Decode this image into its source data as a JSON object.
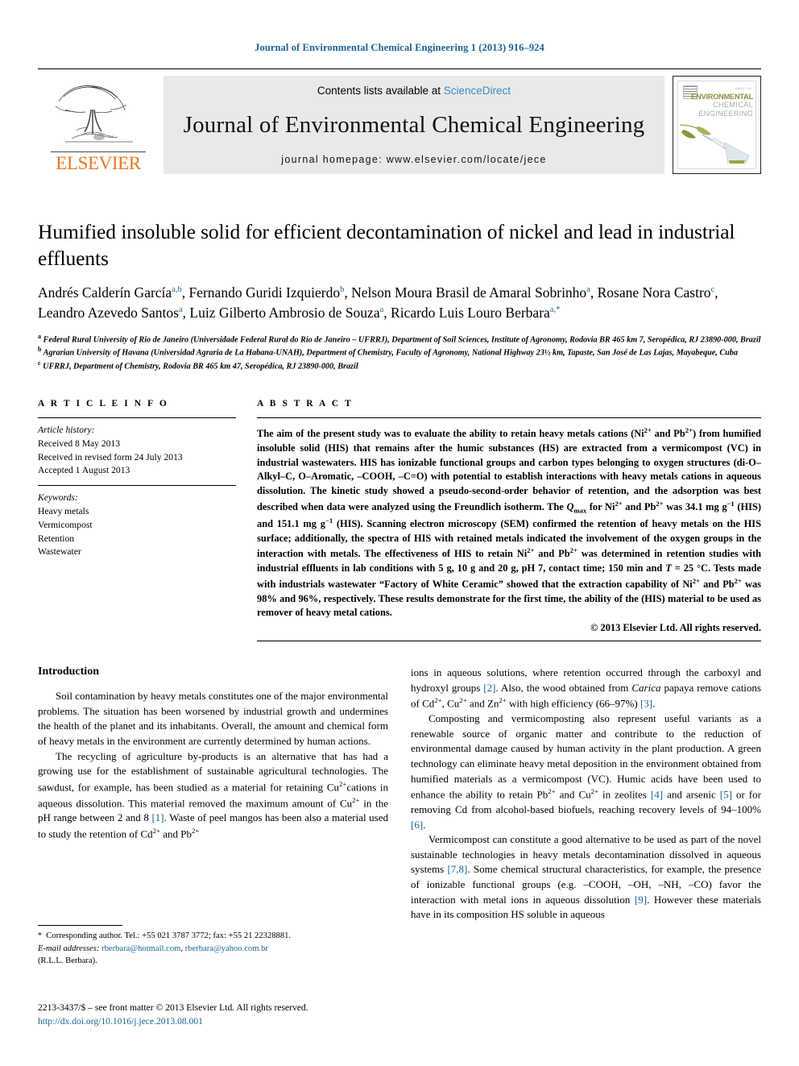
{
  "running_head": "Journal of Environmental Chemical Engineering 1 (2013) 916–924",
  "masthead": {
    "contents_prefix": "Contents lists available at",
    "sciencedirect": "ScienceDirect",
    "journal_title": "Journal of Environmental Chemical Engineering",
    "homepage": "journal homepage: www.elsevier.com/locate/jece",
    "publisher_wordmark": "ELSEVIER",
    "cover": {
      "kicker": "DALL 24",
      "line1": "ENVIRONMENTAL",
      "line2": "CHEMICAL",
      "line3": "ENGINEERING"
    }
  },
  "article": {
    "title": "Humified insoluble solid for efficient decontamination of nickel and lead in industrial effluents",
    "authors": [
      {
        "name": "Andrés Calderín García",
        "sup": "a,b"
      },
      {
        "name": "Fernando Guridi Izquierdo",
        "sup": "b"
      },
      {
        "name": "Nelson Moura Brasil de Amaral Sobrinho",
        "sup": "a"
      },
      {
        "name": "Rosane Nora Castro",
        "sup": "c"
      },
      {
        "name": "Leandro Azevedo Santos",
        "sup": "a"
      },
      {
        "name": "Luiz Gilberto Ambrosio de Souza",
        "sup": "a"
      },
      {
        "name": "Ricardo Luis Louro Berbara",
        "sup": "a,*"
      }
    ],
    "affiliations": [
      {
        "mark": "a",
        "text": "Federal Rural University of Rio de Janeiro (Universidade Federal Rural do Rio de Janeiro – UFRRJ), Department of Soil Sciences, Institute of Agronomy, Rodovia BR 465 km 7, Seropédica, RJ 23890-000, Brazil"
      },
      {
        "mark": "b",
        "text": "Agrarian University of Havana (Universidad Agraria de La Habana-UNAH), Department of Chemistry, Faculty of Agronomy, National Highway 23½ km, Tapaste, San José de Las Lajas, Mayabeque, Cuba"
      },
      {
        "mark": "c",
        "text": "UFRRJ, Department of Chemistry, Rodovia BR 465 km 47, Seropédica, RJ 23890-000, Brazil"
      }
    ]
  },
  "article_info": {
    "label": "A R T I C L E   I N F O",
    "history_label": "Article history:",
    "history": [
      "Received 8 May 2013",
      "Received in revised form 24 July 2013",
      "Accepted 1 August 2013"
    ],
    "keywords_label": "Keywords:",
    "keywords": [
      "Heavy metals",
      "Vermicompost",
      "Retention",
      "Wastewater"
    ]
  },
  "abstract": {
    "label": "A B S T R A C T",
    "paragraph_html": "The aim of the present study was to evaluate the ability to retain heavy metals cations (Ni<sup>2+</sup> and Pb<sup>2+</sup>) from humified insoluble solid (HIS) that remains after the humic substances (HS) are extracted from a vermicompost (VC) in industrial wastewaters. HIS has ionizable functional groups and carbon types belonging to oxygen structures (di-O–Alkyl–C, O–Aromatic, –COOH, –C=O) with potential to establish interactions with heavy metals cations in aqueous dissolution. The kinetic study showed a pseudo-second-order behavior of retention, and the adsorption was best described when data were analyzed using the Freundlich isotherm. The <i>Q</i><sub>max</sub> for Ni<sup>2+</sup> and Pb<sup>2+</sup> was 34.1 mg g<sup>−1</sup> (HIS) and 151.1 mg g<sup>−1</sup> (HIS). Scanning electron microscopy (SEM) confirmed the retention of heavy metals on the HIS surface; additionally, the spectra of HIS with retained metals indicated the involvement of the oxygen groups in the interaction with metals. The effectiveness of HIS to retain Ni<sup>2+</sup> and Pb<sup>2+</sup> was determined in retention studies with industrial effluents in lab conditions with 5 g, 10 g and 20 g, pH 7, contact time; 150 min and <i>T</i> = 25 °C. Tests made with industrials wastewater “Factory of White Ceramic” showed that the extraction capability of Ni<sup>2+</sup> and Pb<sup>2+</sup> was 98% and 96%, respectively. These results demonstrate for the first time, the ability of the (HIS) material to be used as remover of heavy metal cations.",
    "copyright": "© 2013 Elsevier Ltd. All rights reserved."
  },
  "body": {
    "section_title": "Introduction",
    "left_paragraphs_html": [
      "Soil contamination by heavy metals constitutes one of the major environmental problems. The situation has been worsened by industrial growth and undermines the health of the planet and its inhabitants. Overall, the amount and chemical form of heavy metals in the environment are currently determined by human actions.",
      "The recycling of agriculture by-products is an alternative that has had a growing use for the establishment of sustainable agricultural technologies. The sawdust, for example, has been studied as a material for retaining Cu<sup>2+</sup>cations in aqueous dissolution. This material removed the maximum amount of Cu<sup>2+</sup> in the pH range between 2 and 8 <span class=\"ref\">[1]</span>. Waste of peel mangos has been also a material used to study the retention of Cd<sup>2+</sup> and Pb<sup>2+</sup>"
    ],
    "right_paragraphs_html": [
      "ions in aqueous solutions, where retention occurred through the carboxyl and hydroxyl groups <span class=\"ref\">[2]</span>. Also, the wood obtained from <i>Carica</i> papaya remove cations of Cd<sup>2+</sup>, Cu<sup>2+</sup> and Zn<sup>2+</sup> with high efficiency (66–97%) <span class=\"ref\">[3]</span>.",
      "Composting and vermicomposting also represent useful variants as a renewable source of organic matter and contribute to the reduction of environmental damage caused by human activity in the plant production. A green technology can eliminate heavy metal deposition in the environment obtained from humified materials as a vermicompost (VC). Humic acids have been used to enhance the ability to retain Pb<sup>2+</sup> and Cu<sup>2+</sup> in zeolites <span class=\"ref\">[4]</span> and arsenic <span class=\"ref\">[5]</span> or for removing Cd from alcohol-based biofuels, reaching recovery levels of 94–100% <span class=\"ref\">[6]</span>.",
      "Vermicompost can constitute a good alternative to be used as part of the novel sustainable technologies in heavy metals decontamination dissolved in aqueous systems <span class=\"ref\">[7,8]</span>. Some chemical structural characteristics, for example, the presence of ionizable functional groups (e.g. –COOH, –OH, –NH, –CO) favor the interaction with metal ions in aqueous dissolution <span class=\"ref\">[9]</span>. However these materials have in its composition HS soluble in aqueous"
    ]
  },
  "footnote": {
    "corresponding_html": "<span class=\"star\">*</span>&nbsp; Corresponding author. Tel.: +55 021 3787 3772; fax: +55 21 22328881.",
    "email_label": "E-mail addresses:",
    "emails": [
      "rberbara@hotmail.com",
      "rberbara@yahoo.com.br"
    ],
    "email_owner": "(R.L.L. Berbara)."
  },
  "imprint": {
    "line1": "2213-3437/$ – see front matter © 2013 Elsevier Ltd. All rights reserved.",
    "doi": "http://dx.doi.org/10.1016/j.jece.2013.08.001"
  },
  "colors": {
    "link": "#1a6496",
    "sciencedirect": "#3b8bbd",
    "elsevier_orange": "#E87722",
    "banner_gray": "#e9e9e9"
  }
}
